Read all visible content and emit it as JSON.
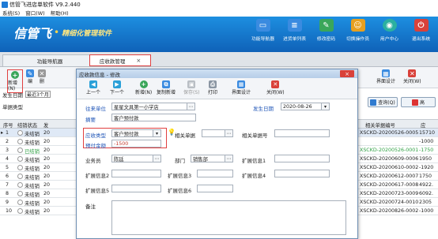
{
  "window": {
    "title": "信管飞进店单软件 V9.2.440"
  },
  "menu": {
    "items": [
      "系统(S)",
      "窗口(W)",
      "帮助(H)"
    ]
  },
  "banner": {
    "logo": "信管飞",
    "slogan": "精细化管理软件",
    "nav": [
      {
        "label": "功能导航器",
        "icon": "monitor-icon",
        "color": "#3a8be0"
      },
      {
        "label": "进货单列表",
        "icon": "list-icon",
        "color": "#3a8be0"
      },
      {
        "label": "修改密码",
        "icon": "key-icon",
        "color": "#3aa65a"
      },
      {
        "label": "切换操作员",
        "icon": "user-icon",
        "color": "#e8a020"
      },
      {
        "label": "用户中心",
        "icon": "globe-icon",
        "color": "#2bb0a0"
      },
      {
        "label": "退出系统",
        "icon": "power-icon",
        "color": "#d9413a"
      }
    ]
  },
  "tabs": [
    {
      "label": "功能导航器"
    },
    {
      "label": "应收款管理",
      "close": "×"
    }
  ],
  "toolbar": {
    "add": "新增(N)",
    "edit": "编",
    "delete": "删",
    "layout": "界面设计",
    "close": "关闭(W)"
  },
  "filter": {
    "date_label": "发生日期",
    "date_value": "最近3个月",
    "unit_type_label": "单据类型",
    "query": "查询(Q)",
    "advanced": "高"
  },
  "grid": {
    "headers": [
      "序号",
      "结销状态",
      "发",
      "相关单据编号",
      "应"
    ],
    "rows": [
      {
        "no": "1",
        "state": "未结销",
        "d": "20",
        "ref": "XSCKD-20200526-0005",
        "amt": "15710",
        "sel": true
      },
      {
        "no": "2",
        "state": "未结销",
        "d": "20",
        "ref": "",
        "amt": "-1000"
      },
      {
        "no": "3",
        "state": "已结销",
        "d": "20",
        "ref": "XSCKD-20200526-0001",
        "amt": "-1750",
        "green": true
      },
      {
        "no": "4",
        "state": "未结销",
        "d": "20",
        "ref": "XSCKD-20200609-0006",
        "amt": "1950"
      },
      {
        "no": "5",
        "state": "未结销",
        "d": "20",
        "ref": "XSCKD-20200610-0002",
        "amt": "-1920"
      },
      {
        "no": "6",
        "state": "未结销",
        "d": "20",
        "ref": "XSCKD-20200612-0007",
        "amt": "1750"
      },
      {
        "no": "7",
        "state": "未结销",
        "d": "20",
        "ref": "XSCKD-20200617-0008",
        "amt": "4922."
      },
      {
        "no": "8",
        "state": "未结销",
        "d": "20",
        "ref": "XSCKD-20200723-0009",
        "amt": "6092."
      },
      {
        "no": "9",
        "state": "未结销",
        "d": "20",
        "ref": "XSCKD-20200724-0010",
        "amt": "2305"
      },
      {
        "no": "10",
        "state": "未结销",
        "d": "20",
        "ref": "XSCKD-20200826-0002",
        "amt": "-1000"
      }
    ]
  },
  "dialog": {
    "title": "应收款信息 - 修改",
    "close": "×",
    "toolbar": [
      "上一个",
      "下一个",
      "新增(N)",
      "复制新增",
      "保存(S)",
      "打印",
      "界面设计",
      "关闭(W)"
    ],
    "fields": {
      "unit_label": "往来单位",
      "unit_value": "星星文具第一小学店",
      "date_label": "发生日期",
      "date_value": "2020-08-26",
      "summary_label": "摘要",
      "summary_value": "客户预付款",
      "type_label": "应收类型",
      "type_value": "客户预付款",
      "related_label": "相关单据",
      "related_no_label": "相关单据号",
      "amount_label": "预付金额",
      "amount_value": "-1500",
      "salesman_label": "业务员",
      "salesman_value": "陈廷",
      "dept_label": "部门",
      "dept_value": "销售部",
      "ext1": "扩展信息1",
      "ext2": "扩展信息2",
      "ext3": "扩展信息3",
      "ext4": "扩展信息4",
      "ext5": "扩展信息5",
      "ext6": "扩展信息6",
      "remark_label": "备注"
    }
  },
  "colors": {
    "accent_red": "#e04040",
    "banner_blue": "#1478cc",
    "label_blue": "#1f55b7"
  }
}
